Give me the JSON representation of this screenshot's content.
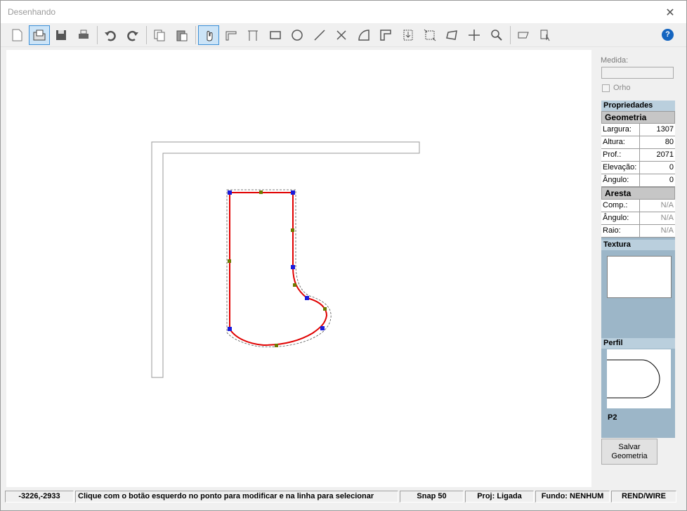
{
  "window": {
    "title": "Desenhando",
    "close_glyph": "✕"
  },
  "toolbar": {
    "tools": [
      {
        "name": "new-doc-icon"
      },
      {
        "name": "open-folder-icon",
        "active": true
      },
      {
        "name": "save-icon"
      },
      {
        "name": "print-icon"
      },
      {
        "sep": true
      },
      {
        "name": "undo-icon"
      },
      {
        "name": "redo-icon"
      },
      {
        "sep": true
      },
      {
        "name": "copy-icon"
      },
      {
        "name": "paste-icon"
      },
      {
        "sep": true
      },
      {
        "name": "hand-select-icon",
        "active": true
      },
      {
        "name": "draw-shape-icon"
      },
      {
        "name": "dimension-icon"
      },
      {
        "name": "rectangle-icon"
      },
      {
        "name": "circle-icon"
      },
      {
        "name": "line-icon"
      },
      {
        "name": "trim-icon"
      },
      {
        "name": "arc-icon"
      },
      {
        "name": "corner-icon"
      },
      {
        "name": "insert-icon"
      },
      {
        "name": "resize-icon"
      },
      {
        "name": "rotate-icon"
      },
      {
        "name": "move-icon"
      },
      {
        "name": "zoom-add-icon"
      },
      {
        "sep": true
      },
      {
        "name": "layer-icon"
      },
      {
        "name": "edit-cursor-icon"
      }
    ],
    "help_label": "?"
  },
  "side": {
    "medida_label": "Medida:",
    "medida_value": "",
    "orho_label": "Orho",
    "props_title": "Propriedades",
    "geometria": {
      "title": "Geometria",
      "rows": [
        {
          "k": "Largura:",
          "v": "1307"
        },
        {
          "k": "Altura:",
          "v": "80"
        },
        {
          "k": "Prof.:",
          "v": "2071"
        },
        {
          "k": "Elevação:",
          "v": "0"
        },
        {
          "k": "Ângulo:",
          "v": "0"
        }
      ]
    },
    "aresta": {
      "title": "Aresta",
      "rows": [
        {
          "k": "Comp.:",
          "v": "N/A"
        },
        {
          "k": "Ângulo:",
          "v": "N/A"
        },
        {
          "k": "Raio:",
          "v": "N/A"
        }
      ]
    },
    "textura_label": "Textura",
    "perfil_label": "Perfil",
    "perfil_name": "P2",
    "save_label_1": "Salvar",
    "save_label_2": "Geometria"
  },
  "status": {
    "coords": "-3226,-2933",
    "hint": "Clique com o botão esquerdo no ponto para modificar e na linha para selecionar",
    "snap": "Snap 50",
    "proj": "Proj: Ligada",
    "fundo": "Fundo: NENHUM",
    "mode": "REND/WIRE"
  },
  "colors": {
    "shape_outline": "#e00000",
    "vertex": "#1a1adb",
    "midpoint": "#6d7a00",
    "panel": "#9cb6c8"
  }
}
